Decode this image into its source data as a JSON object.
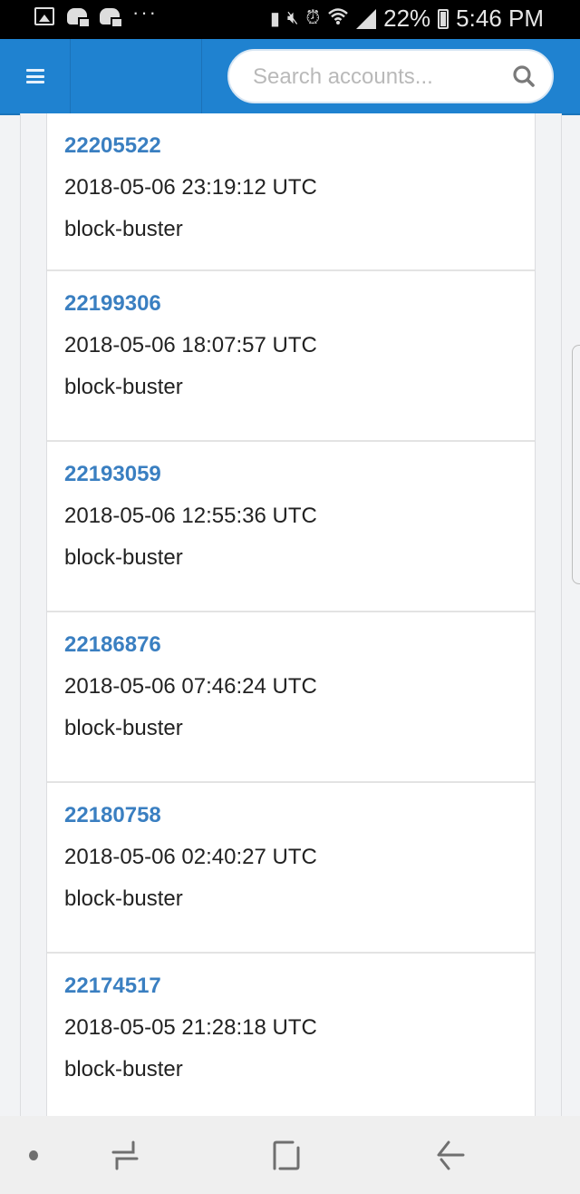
{
  "status_bar": {
    "battery_percent": "22%",
    "time": "5:46 PM",
    "left_icons": [
      "gallery-icon",
      "discord-icon",
      "discord-icon",
      "more-notifications-icon"
    ],
    "right_icons": [
      "battery-saver-icon",
      "mute-icon",
      "alarm-icon",
      "wifi-icon",
      "signal-icon",
      "battery-icon"
    ],
    "more_glyph": "···"
  },
  "header": {
    "menu_icon": "hamburger-icon",
    "search": {
      "placeholder": "Search accounts...",
      "value": "",
      "icon": "search-icon"
    }
  },
  "colors": {
    "header_bg": "#1f82d0",
    "link": "#3a7fc1",
    "text": "#222222"
  },
  "blocks": [
    {
      "number": "22205522",
      "timestamp": "2018-05-06 23:19:12 UTC",
      "witness": "block-buster"
    },
    {
      "number": "22199306",
      "timestamp": "2018-05-06 18:07:57 UTC",
      "witness": "block-buster"
    },
    {
      "number": "22193059",
      "timestamp": "2018-05-06 12:55:36 UTC",
      "witness": "block-buster"
    },
    {
      "number": "22186876",
      "timestamp": "2018-05-06 07:46:24 UTC",
      "witness": "block-buster"
    },
    {
      "number": "22180758",
      "timestamp": "2018-05-06 02:40:27 UTC",
      "witness": "block-buster"
    },
    {
      "number": "22174517",
      "timestamp": "2018-05-05 21:28:18 UTC",
      "witness": "block-buster"
    }
  ],
  "nav_bar": {
    "buttons": [
      "recent-apps-icon",
      "home-icon",
      "back-icon"
    ]
  }
}
